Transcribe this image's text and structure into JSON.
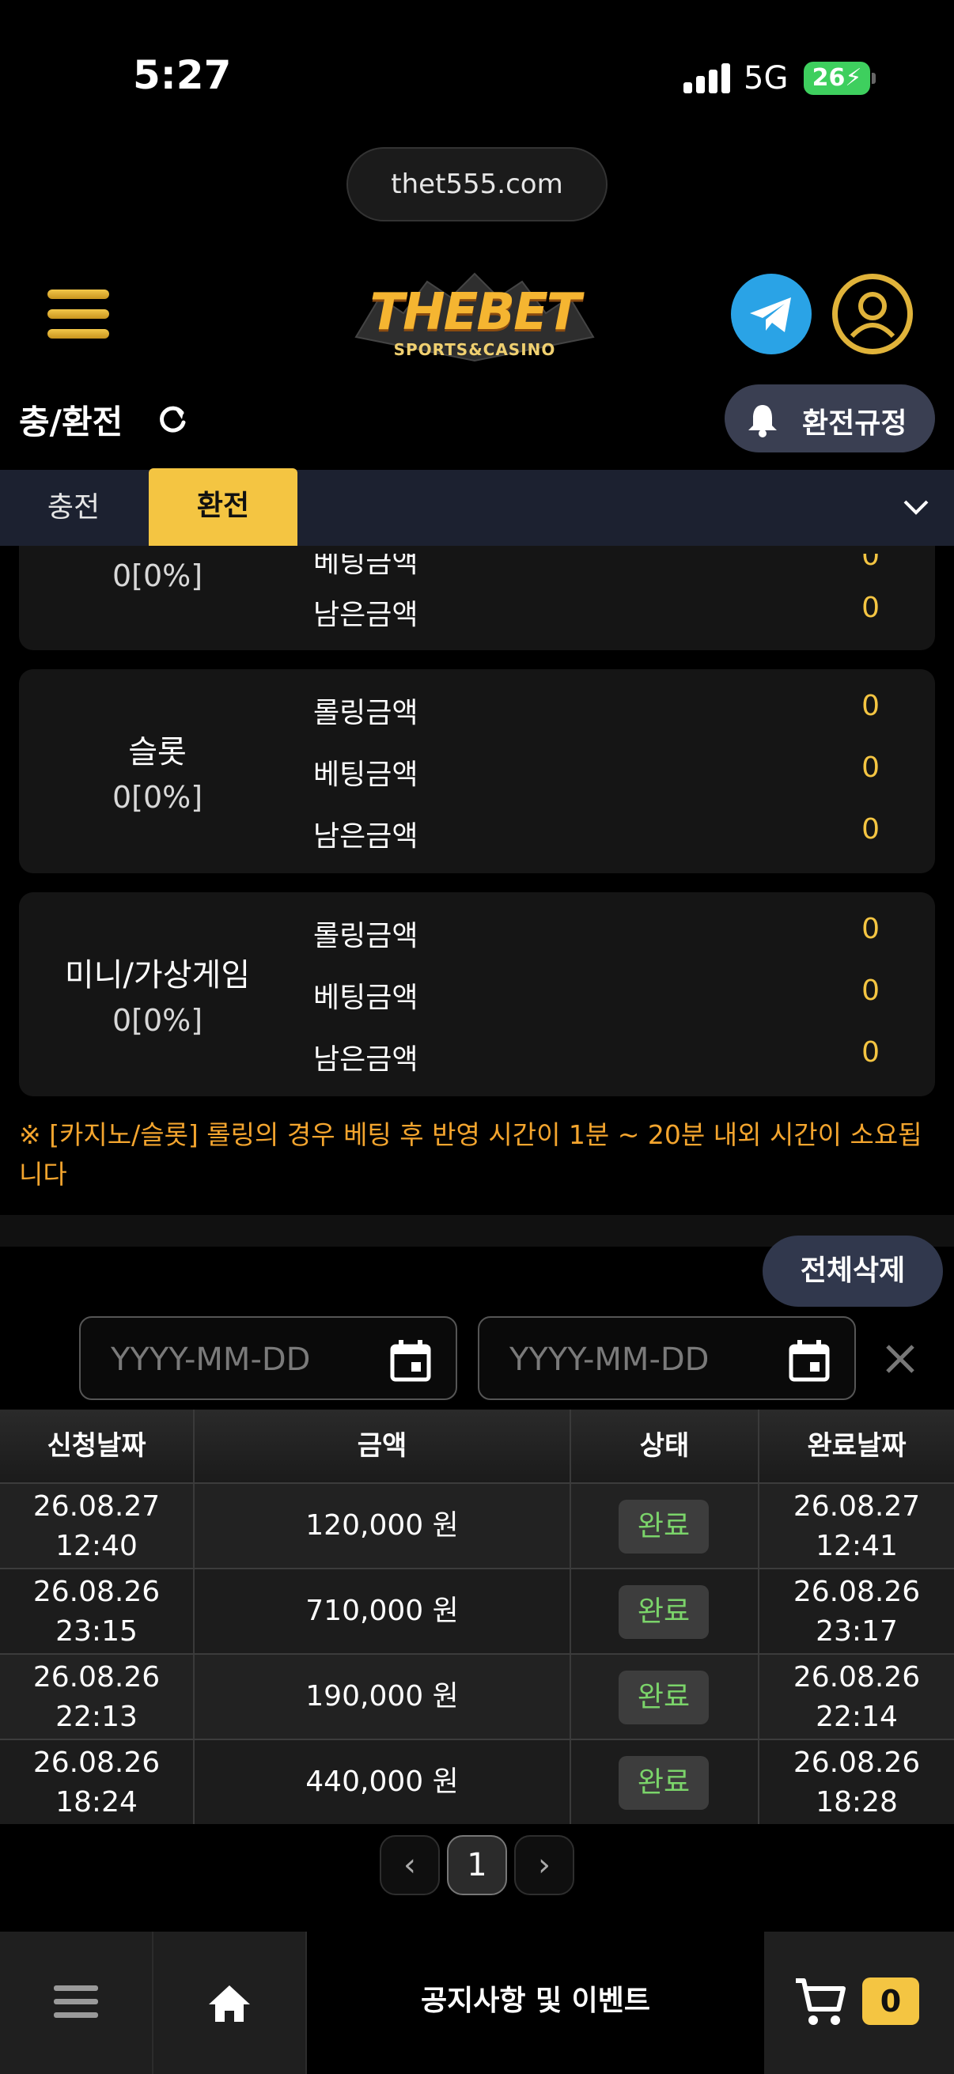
{
  "status_bar": {
    "time": "5:27",
    "network": "5G",
    "battery": "26"
  },
  "browser": {
    "url": "thet555.com"
  },
  "header": {
    "logo_main": "THEBET",
    "logo_sub": "SPORTS&CASINO"
  },
  "page": {
    "title": "충/환전",
    "rule_button": "환전규정"
  },
  "tabs": [
    {
      "label": "충전",
      "active": false
    },
    {
      "label": "환전",
      "active": true
    }
  ],
  "rolling": {
    "row_labels": [
      "롤링금액",
      "베팅금액",
      "남은금액"
    ],
    "cards": [
      {
        "name": "",
        "percent": "0[0%]",
        "values": [
          "0",
          "0"
        ],
        "labels": [
          "베팅금액",
          "남은금액"
        ]
      },
      {
        "name": "슬롯",
        "percent": "0[0%]",
        "values": [
          "0",
          "0",
          "0"
        ],
        "labels": [
          "롤링금액",
          "베팅금액",
          "남은금액"
        ]
      },
      {
        "name": "미니/가상게임",
        "percent": "0[0%]",
        "values": [
          "0",
          "0",
          "0"
        ],
        "labels": [
          "롤링금액",
          "베팅금액",
          "남은금액"
        ]
      }
    ],
    "notice": "※ [카지노/슬롯] 롤링의 경우 베팅 후 반영 시간이 1분 ~ 20분 내외 시간이 소요됩니다"
  },
  "history": {
    "delete_all": "전체삭제",
    "date_placeholder": "YYYY-MM-DD",
    "columns": [
      "신청날짜",
      "금액",
      "상태",
      "완료날짜"
    ],
    "rows": [
      {
        "req_date": "26.08.27",
        "req_time": "12:40",
        "amount": "120,000 원",
        "status": "완료",
        "done_date": "26.08.27",
        "done_time": "12:41"
      },
      {
        "req_date": "26.08.26",
        "req_time": "23:15",
        "amount": "710,000 원",
        "status": "완료",
        "done_date": "26.08.26",
        "done_time": "23:17"
      },
      {
        "req_date": "26.08.26",
        "req_time": "22:13",
        "amount": "190,000 원",
        "status": "완료",
        "done_date": "26.08.26",
        "done_time": "22:14"
      },
      {
        "req_date": "26.08.26",
        "req_time": "18:24",
        "amount": "440,000 원",
        "status": "완료",
        "done_date": "26.08.26",
        "done_time": "18:28"
      }
    ]
  },
  "pagination": {
    "prev": "‹",
    "current": "1",
    "next": "›"
  },
  "bottom_nav": {
    "notice": "공지사항 및 이벤트",
    "cart_count": "0"
  },
  "colors": {
    "accent": "#f4c542",
    "notice": "#f4a52e",
    "status_done": "#7bd46a",
    "telegram": "#2aa3e6"
  }
}
